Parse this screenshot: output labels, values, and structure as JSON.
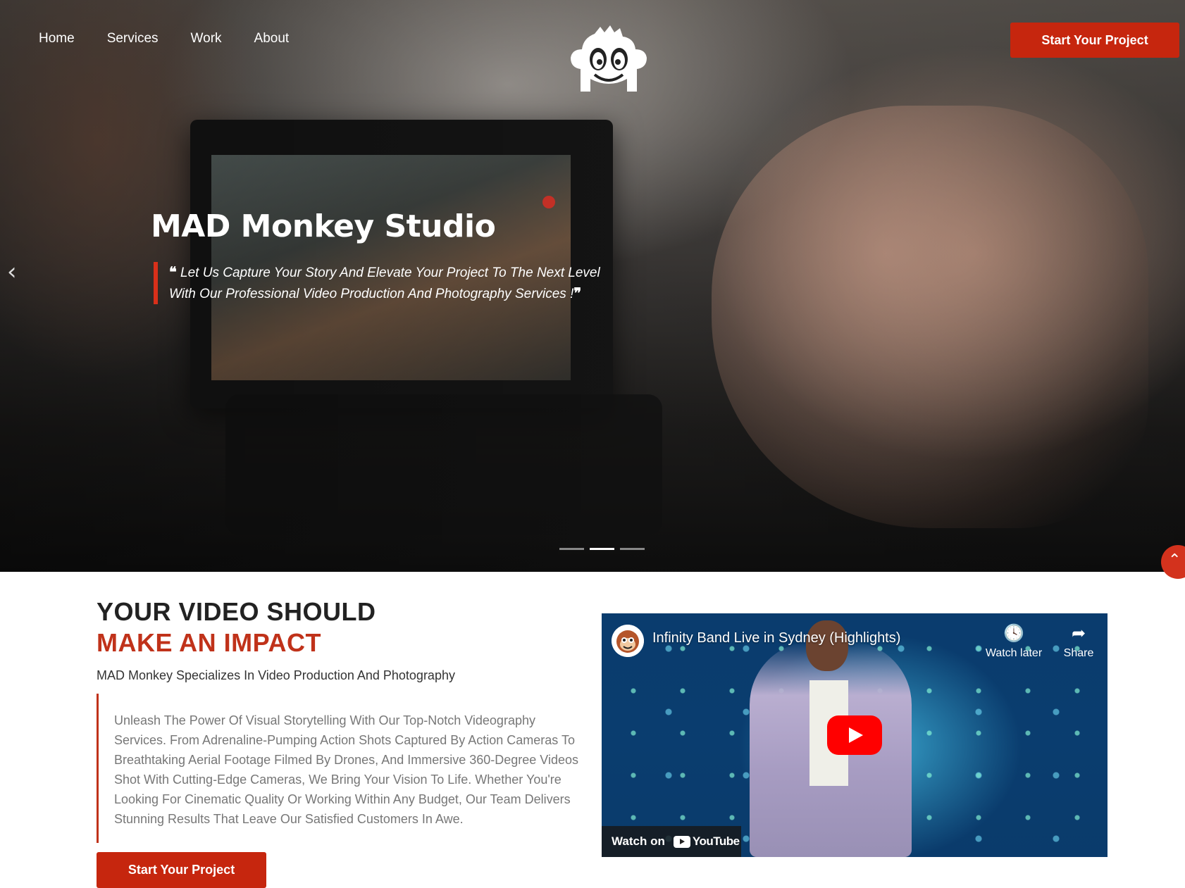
{
  "nav": {
    "items": [
      "Home",
      "Services",
      "Work",
      "About"
    ],
    "cta_label": "Start Your Project"
  },
  "hero": {
    "title": "MAD Monkey Studio",
    "quote_line1": "Let Us Capture Your Story And Elevate Your Project To The Next Level",
    "quote_line2": "With Our Professional Video Production And Photography Services !",
    "prev_arrow": "‹",
    "slide_count": 3,
    "active_slide": 2
  },
  "intro": {
    "heading_line1": "YOUR VIDEO SHOULD",
    "heading_line2": "MAKE AN IMPACT",
    "subheading": "MAD Monkey Specializes In Video Production And Photography",
    "description": "Unleash The Power Of Visual Storytelling With Our Top-Notch Videography Services. From Adrenaline-Pumping Action Shots Captured By Action Cameras To Breathtaking Aerial Footage Filmed By Drones, And Immersive 360-Degree Videos Shot With Cutting-Edge Cameras, We Bring Your Vision To Life. Whether You're Looking For Cinematic Quality Or Working Within Any Budget, Our Team Delivers Stunning Results That Leave Our Satisfied Customers In Awe.",
    "cta_label": "Start Your Project"
  },
  "video": {
    "title": "Infinity Band Live in Sydney (Highlights)",
    "watch_later": "Watch later",
    "share": "Share",
    "watch_on": "Watch on",
    "youtube": "YouTube"
  },
  "colors": {
    "accent": "#c6260e",
    "heading_accent": "#c0321a",
    "body_text": "#777777"
  }
}
